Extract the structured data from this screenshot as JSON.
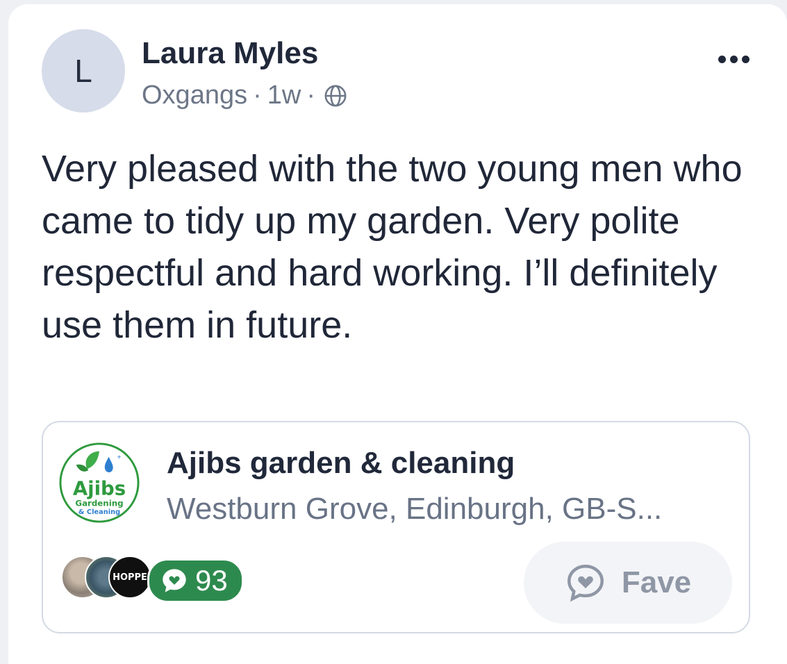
{
  "post": {
    "avatar_letter": "L",
    "author": "Laura Myles",
    "location": "Oxgangs",
    "time": "1w",
    "separator": "·",
    "visibility_icon": "globe-icon",
    "text": "Very pleased with the two young men who came to tidy up my garden. Very polite respectful and hard working. I’ll definitely use them in future."
  },
  "business": {
    "name": "Ajibs garden & cleaning",
    "address": "Westburn Grove, Edinburgh,  GB-S...",
    "logo_text_main": "Ajibs",
    "logo_text_sub": "Gardening",
    "logo_text_sub2": "& Cleaning",
    "reviewer_badge_text": "HOPPE",
    "review_count": "93",
    "fave_label": "Fave"
  },
  "colors": {
    "review_pill": "#2d8a4e",
    "logo_green": "#2e9a3e",
    "logo_blue": "#2f7fd0"
  }
}
